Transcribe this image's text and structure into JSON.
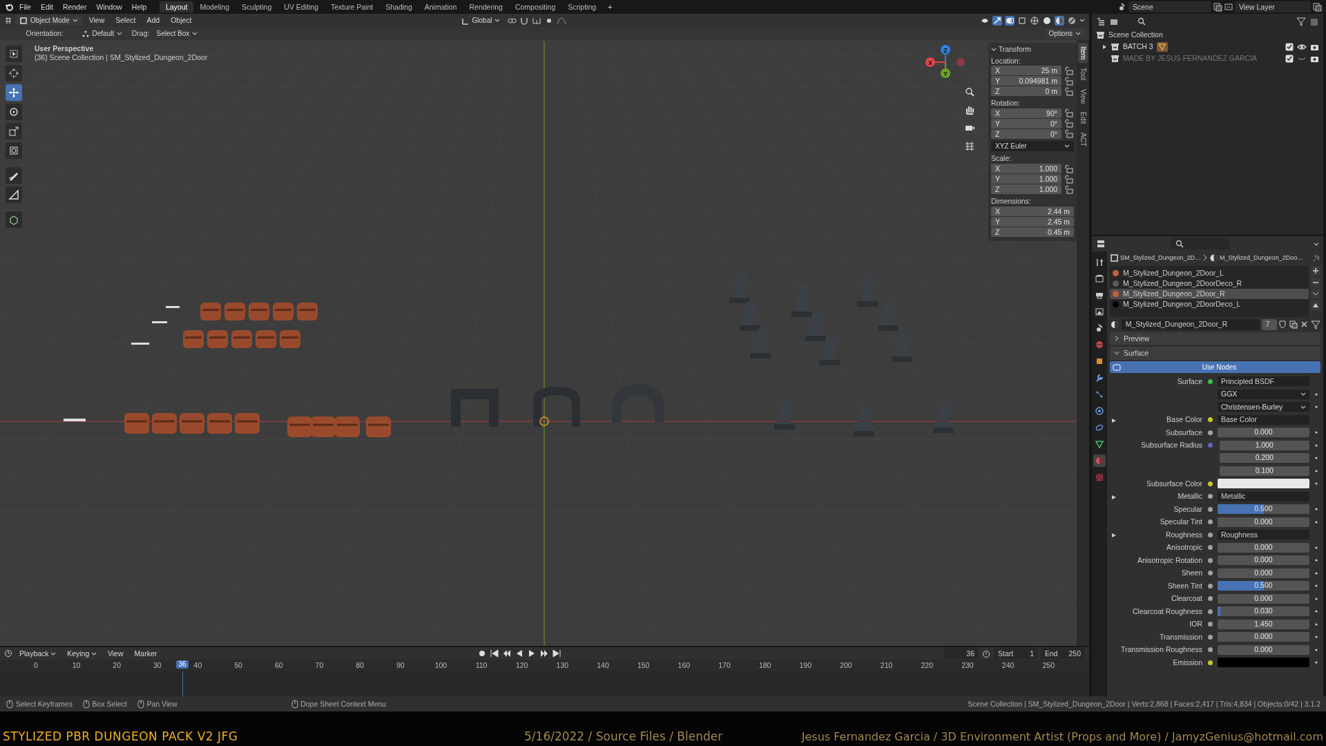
{
  "topbar": {
    "menus": [
      "File",
      "Edit",
      "Render",
      "Window",
      "Help"
    ],
    "workspaces": [
      {
        "label": "Layout",
        "selected": true
      },
      {
        "label": "Modeling",
        "selected": false
      },
      {
        "label": "Sculpting",
        "selected": false
      },
      {
        "label": "UV Editing",
        "selected": false
      },
      {
        "label": "Texture Paint",
        "selected": false
      },
      {
        "label": "Shading",
        "selected": false
      },
      {
        "label": "Animation",
        "selected": false
      },
      {
        "label": "Rendering",
        "selected": false
      },
      {
        "label": "Compositing",
        "selected": false
      },
      {
        "label": "Scripting",
        "selected": false
      }
    ],
    "add_tab": "+",
    "scene": "Scene",
    "view_layer": "View Layer"
  },
  "viewport_header": {
    "mode": "Object Mode",
    "menus": [
      "View",
      "Select",
      "Add",
      "Object"
    ],
    "orientation": "Global",
    "options": "Options",
    "shading_modes": [
      {
        "kind": "wireframe",
        "selected": false
      },
      {
        "kind": "solid",
        "selected": false
      },
      {
        "kind": "material",
        "selected": true
      },
      {
        "kind": "rendered",
        "selected": false
      }
    ]
  },
  "tool_settings": {
    "orientation_label": "Orientation:",
    "orientation": "Default",
    "drag_label": "Drag:",
    "drag": "Select Box"
  },
  "tools": [
    {
      "kind": "select",
      "selected": false
    },
    {
      "kind": "cursor",
      "selected": false
    },
    {
      "kind": "move",
      "selected": true
    },
    {
      "kind": "rotate",
      "selected": false
    },
    {
      "kind": "scale",
      "selected": false
    },
    {
      "kind": "transform",
      "selected": false
    },
    {
      "kind": "annotate",
      "selected": false
    },
    {
      "kind": "measure",
      "selected": false
    },
    {
      "kind": "add-cube",
      "selected": false
    }
  ],
  "viewport": {
    "view_name": "User Perspective",
    "info": "(36) Scene Collection | SM_Stylized_Dungeon_2Door"
  },
  "gizmo": [
    {
      "label": "Z",
      "color": "#2f7fe0"
    },
    {
      "label": "Y",
      "color": "#6ea22a"
    },
    {
      "label": "X",
      "color": "#e0454f"
    }
  ],
  "sidebar": {
    "tabs": [
      {
        "label": "Item",
        "selected": true
      },
      {
        "label": "Tool",
        "selected": false
      },
      {
        "label": "View",
        "selected": false
      },
      {
        "label": "Edit",
        "selected": false
      },
      {
        "label": "ACT",
        "selected": false
      }
    ],
    "title": "Transform",
    "groups": [
      {
        "label": "Location:",
        "lockable": true,
        "fields": [
          {
            "axis": "X",
            "value": "25 m"
          },
          {
            "axis": "Y",
            "value": "0.094981 m"
          },
          {
            "axis": "Z",
            "value": "0 m"
          }
        ]
      },
      {
        "label": "Rotation:",
        "lockable": true,
        "fields": [
          {
            "axis": "X",
            "value": "90°"
          },
          {
            "axis": "Y",
            "value": "0°"
          },
          {
            "axis": "Z",
            "value": "0°"
          }
        ],
        "mode": "XYZ Euler"
      },
      {
        "label": "Scale:",
        "lockable": true,
        "fields": [
          {
            "axis": "X",
            "value": "1.000"
          },
          {
            "axis": "Y",
            "value": "1.000"
          },
          {
            "axis": "Z",
            "value": "1.000"
          }
        ]
      },
      {
        "label": "Dimensions:",
        "lockable": false,
        "fields": [
          {
            "axis": "X",
            "value": "2.44 m"
          },
          {
            "axis": "Y",
            "value": "2.45 m"
          },
          {
            "axis": "Z",
            "value": "0.45 m"
          }
        ]
      }
    ]
  },
  "outliner": {
    "root": "Scene Collection",
    "items": [
      {
        "name": "BATCH 3",
        "kind": "parent",
        "expanded": false,
        "visible": true,
        "checked": true
      },
      {
        "name": "MADE BY JESUS FERNANDEZ GARCIA",
        "kind": "leaf",
        "visible": false,
        "checked": true
      }
    ]
  },
  "properties": {
    "breadcrumb": [
      "SM_Stylized_Dungeon_2D…",
      "M_Stylized_Dungeon_2Doo…"
    ],
    "tabs": [
      {
        "kind": "tool",
        "selected": false
      },
      {
        "kind": "render",
        "selected": false
      },
      {
        "kind": "output",
        "selected": false
      },
      {
        "kind": "view-layer",
        "selected": false
      },
      {
        "kind": "scene",
        "selected": false
      },
      {
        "kind": "world",
        "selected": false
      },
      {
        "kind": "object",
        "selected": false
      },
      {
        "kind": "modifier",
        "selected": false
      },
      {
        "kind": "particles",
        "selected": false
      },
      {
        "kind": "physics",
        "selected": false
      },
      {
        "kind": "constraint",
        "selected": false
      },
      {
        "kind": "data",
        "selected": false
      },
      {
        "kind": "material",
        "selected": true
      },
      {
        "kind": "texture",
        "selected": false
      }
    ],
    "slots": [
      {
        "name": "M_Stylized_Dungeon_2Door_L",
        "color": "#c0603a",
        "selected": false
      },
      {
        "name": "M_Stylized_Dungeon_2DoorDeco_R",
        "color": "#555a60",
        "selected": false
      },
      {
        "name": "M_Stylized_Dungeon_2Door_R",
        "color": "#c0603a",
        "selected": true
      },
      {
        "name": "M_Stylized_Dungeon_2DoorDeco_L",
        "color": "#000000",
        "selected": false
      }
    ],
    "material": {
      "name": "M_Stylized_Dungeon_2Door_R",
      "users": "7"
    },
    "panels": [
      {
        "title": "Preview",
        "expanded": false
      },
      {
        "title": "Surface",
        "expanded": true
      }
    ],
    "use_nodes": "Use Nodes",
    "rows": [
      {
        "kind": "link",
        "label": "Surface",
        "color": "#3fbf4a",
        "value": "Principled BSDF",
        "expandable": false
      },
      {
        "kind": "enum",
        "value": "GGX",
        "expandable": false
      },
      {
        "kind": "enum",
        "value": "Christensen-Burley",
        "expandable": false
      },
      {
        "kind": "link",
        "label": "Base Color",
        "color": "#c7c729",
        "value": "Base Color",
        "expandable": true
      },
      {
        "kind": "slider",
        "label": "Subsurface",
        "color": "#a1a1a1",
        "value": "0.000",
        "level": 0,
        "expandable": false
      },
      {
        "kind": "vector",
        "label": "Subsurface Radius",
        "color": "#6363c7",
        "values": [
          "1.000",
          "0.200",
          "0.100"
        ],
        "expandable": false
      },
      {
        "kind": "swatch",
        "label": "Subsurface Color",
        "color": "#e8e8e8",
        "expandable": false
      },
      {
        "kind": "link",
        "label": "Metallic",
        "color": "#a1a1a1",
        "value": "Metallic",
        "expandable": true
      },
      {
        "kind": "slider",
        "label": "Specular",
        "color": "#a1a1a1",
        "value": "0.500",
        "level": 0.5,
        "expandable": false
      },
      {
        "kind": "slider",
        "label": "Specular Tint",
        "color": "#a1a1a1",
        "value": "0.000",
        "level": 0,
        "expandable": false
      },
      {
        "kind": "link",
        "label": "Roughness",
        "color": "#a1a1a1",
        "value": "Roughness",
        "expandable": true
      },
      {
        "kind": "slider",
        "label": "Anisotropic",
        "color": "#a1a1a1",
        "value": "0.000",
        "level": 0,
        "expandable": false
      },
      {
        "kind": "slider",
        "label": "Anisotropic Rotation",
        "color": "#a1a1a1",
        "value": "0.000",
        "level": 0,
        "expandable": false
      },
      {
        "kind": "slider",
        "label": "Sheen",
        "color": "#a1a1a1",
        "value": "0.000",
        "level": 0,
        "expandable": false
      },
      {
        "kind": "slider",
        "label": "Sheen Tint",
        "color": "#a1a1a1",
        "value": "0.500",
        "level": 0.5,
        "expandable": false
      },
      {
        "kind": "slider",
        "label": "Clearcoat",
        "color": "#a1a1a1",
        "value": "0.000",
        "level": 0,
        "expandable": false
      },
      {
        "kind": "slider",
        "label": "Clearcoat Roughness",
        "color": "#a1a1a1",
        "value": "0.030",
        "level": 0.03,
        "expandable": false
      },
      {
        "kind": "slider",
        "label": "IOR",
        "color": "#a1a1a1",
        "value": "1.450",
        "level": 0,
        "expandable": false
      },
      {
        "kind": "slider",
        "label": "Transmission",
        "color": "#a1a1a1",
        "value": "0.000",
        "level": 0,
        "expandable": false
      },
      {
        "kind": "slider",
        "label": "Transmission Roughness",
        "color": "#a1a1a1",
        "value": "0.000",
        "level": 0,
        "expandable": false
      },
      {
        "kind": "swatch",
        "label": "Emission",
        "color": "#000000",
        "expandable": false
      }
    ]
  },
  "timeline": {
    "menus": [
      "Playback",
      "Keying",
      "View",
      "Marker"
    ],
    "current_frame": "36",
    "start_label": "Start",
    "start": "1",
    "end_label": "End",
    "end": "250",
    "ticks": [
      "0",
      "10",
      "20",
      "30",
      "40",
      "50",
      "60",
      "70",
      "80",
      "90",
      "100",
      "110",
      "120",
      "130",
      "140",
      "150",
      "160",
      "170",
      "180",
      "190",
      "200",
      "210",
      "220",
      "230",
      "240",
      "250"
    ],
    "playhead": "36"
  },
  "status_bar": {
    "hints": [
      "Select Keyframes",
      "Box Select",
      "Pan View",
      "Dope Sheet Context Menu"
    ],
    "stats": "Scene Collection | SM_Stylized_Dungeon_2Door | Verts:2,868 | Faces:2,417 | Tris:4,834 | Objects:0/42 | 3.1.2"
  },
  "banner": {
    "title": "STYLIZED PBR DUNGEON PACK V2 JFG",
    "meta": "5/16/2022 / Source Files / Blender",
    "credit": "Jesus Fernandez Garcia / 3D Environment Artist (Props and More) / JamyzGenius@hotmail.com"
  }
}
